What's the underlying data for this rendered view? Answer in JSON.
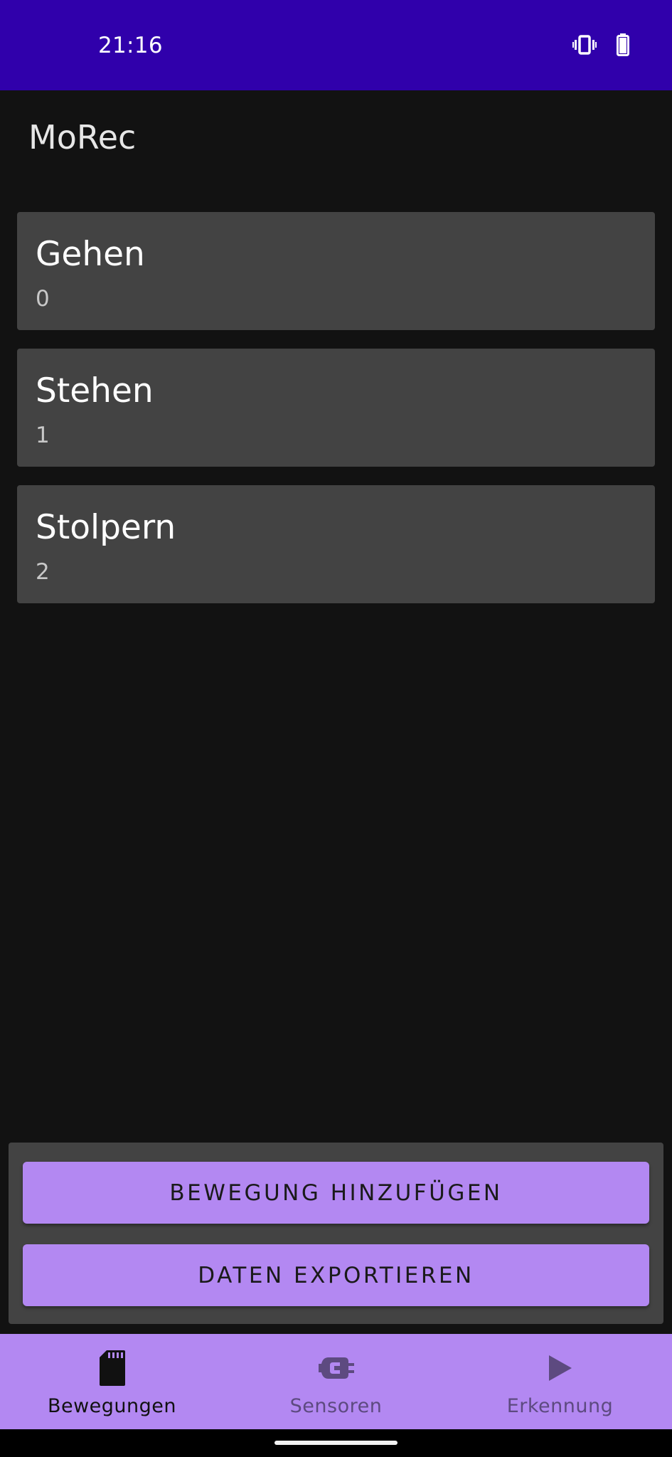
{
  "status_bar": {
    "time": "21:16",
    "background": "#3000AB",
    "icons": [
      "vibrate-icon",
      "battery-icon"
    ]
  },
  "app_bar": {
    "title": "MoRec"
  },
  "movements": [
    {
      "name": "Gehen",
      "id": "0"
    },
    {
      "name": "Stehen",
      "id": "1"
    },
    {
      "name": "Stolpern",
      "id": "2"
    }
  ],
  "actions": {
    "add_movement": "BEWEGUNG HINZUFÜGEN",
    "export_data": "DATEN EXPORTIEREN",
    "accent": "#B388F2"
  },
  "bottom_nav": {
    "items": [
      {
        "label": "Bewegungen",
        "icon": "sd-card-icon",
        "selected": true
      },
      {
        "label": "Sensoren",
        "icon": "sensor-plug-icon",
        "selected": false
      },
      {
        "label": "Erkennung",
        "icon": "play-icon",
        "selected": false
      }
    ],
    "active_color": "#111111",
    "inactive_color": "#5D4A80"
  }
}
